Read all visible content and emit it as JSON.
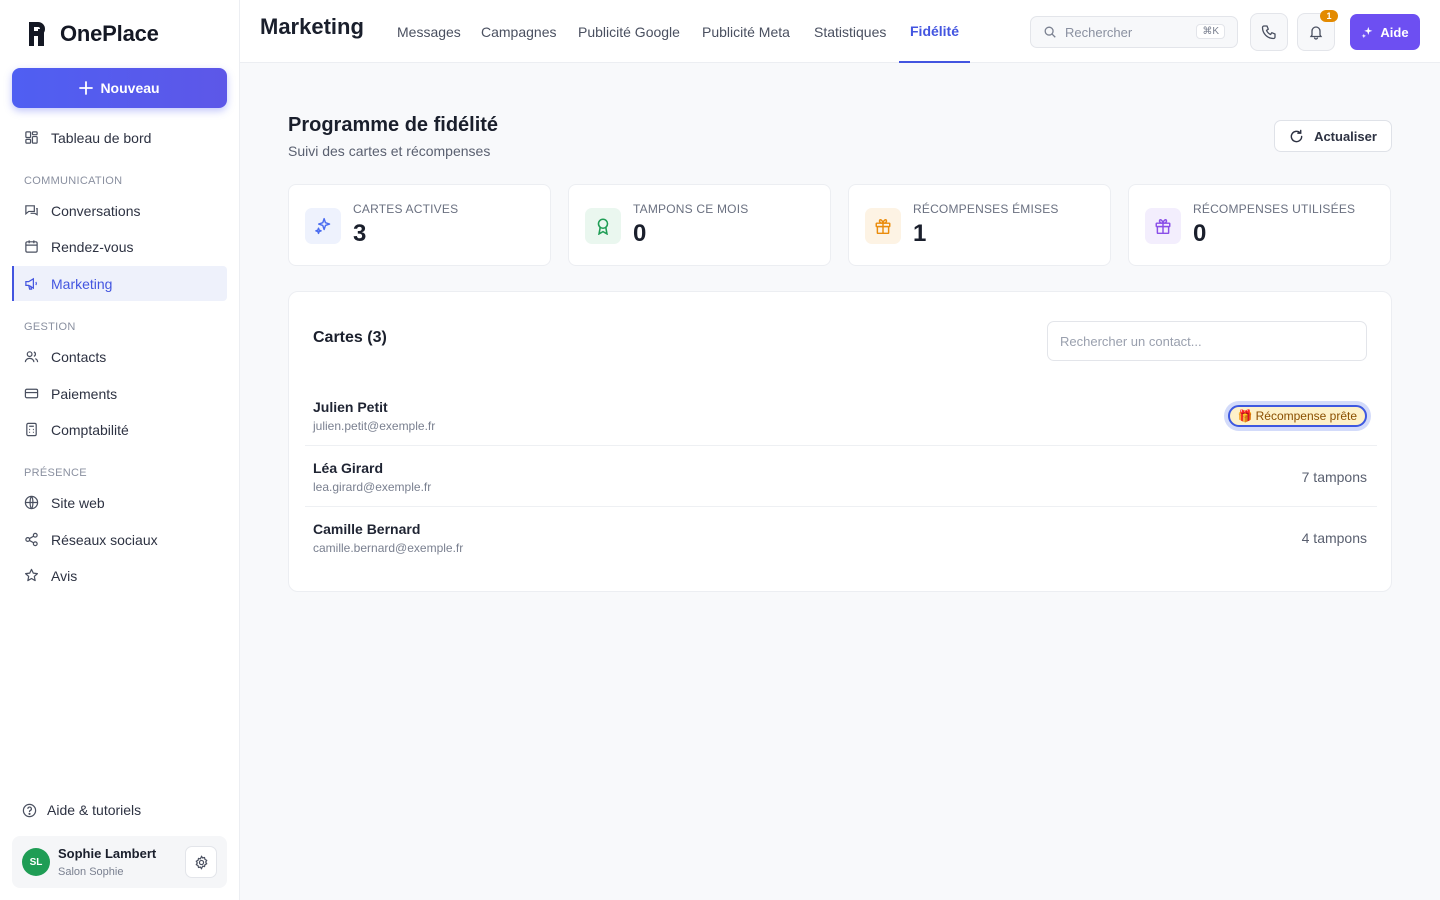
{
  "brand": {
    "name": "OnePlace"
  },
  "sidebar": {
    "new_label": "Nouveau",
    "items": {
      "dashboard": "Tableau de bord",
      "conversations": "Conversations",
      "appointments": "Rendez-vous",
      "marketing": "Marketing",
      "contacts": "Contacts",
      "payments": "Paiements",
      "accounting": "Comptabilité",
      "website": "Site web",
      "social": "Réseaux sociaux",
      "reviews": "Avis"
    },
    "sections": {
      "communication": "COMMUNICATION",
      "management": "GESTION",
      "presence": "PRÉSENCE"
    },
    "help_label": "Aide & tutoriels",
    "user": {
      "initials": "SL",
      "name": "Sophie Lambert",
      "business": "Salon Sophie"
    }
  },
  "topbar": {
    "title": "Marketing",
    "tabs": [
      "Messages",
      "Campagnes",
      "Publicité Google",
      "Publicité Meta",
      "Statistiques",
      "Fidélité"
    ],
    "active_tab": "Fidélité",
    "search_placeholder": "Rechercher",
    "shortcut": "⌘K",
    "notifications_count": "1",
    "aide_label": "Aide"
  },
  "main": {
    "title": "Programme de fidélité",
    "subtitle": "Suivi des cartes et récompenses",
    "refresh_label": "Actualiser",
    "stats": [
      {
        "label": "Cartes actives",
        "value": "3",
        "color": "#4a6cf0",
        "bg": "#eef2fd",
        "icon": "sparkles-icon"
      },
      {
        "label": "Tampons ce mois",
        "value": "0",
        "color": "#1f9d55",
        "bg": "#eaf7ef",
        "icon": "award-icon"
      },
      {
        "label": "Récompenses émises",
        "value": "1",
        "color": "#ea8c0c",
        "bg": "#fdf3e4",
        "icon": "gift-icon"
      },
      {
        "label": "Récompenses utilisées",
        "value": "0",
        "color": "#8a4fe8",
        "bg": "#f3eefd",
        "icon": "gift-icon"
      }
    ],
    "cards": {
      "title": "Cartes (3)",
      "search_placeholder": "Rechercher un contact...",
      "rows": [
        {
          "name": "Julien Petit",
          "email": "julien.petit@exemple.fr",
          "status": "Récompense prête",
          "status_icon": "🎁"
        },
        {
          "name": "Léa Girard",
          "email": "lea.girard@exemple.fr",
          "status": "7 tampons"
        },
        {
          "name": "Camille Bernard",
          "email": "camille.bernard@exemple.fr",
          "status": "4 tampons"
        }
      ]
    }
  },
  "colors": {
    "accent": "#4355e0",
    "aide": "#6d4ff2",
    "badge": "#e38a00"
  }
}
